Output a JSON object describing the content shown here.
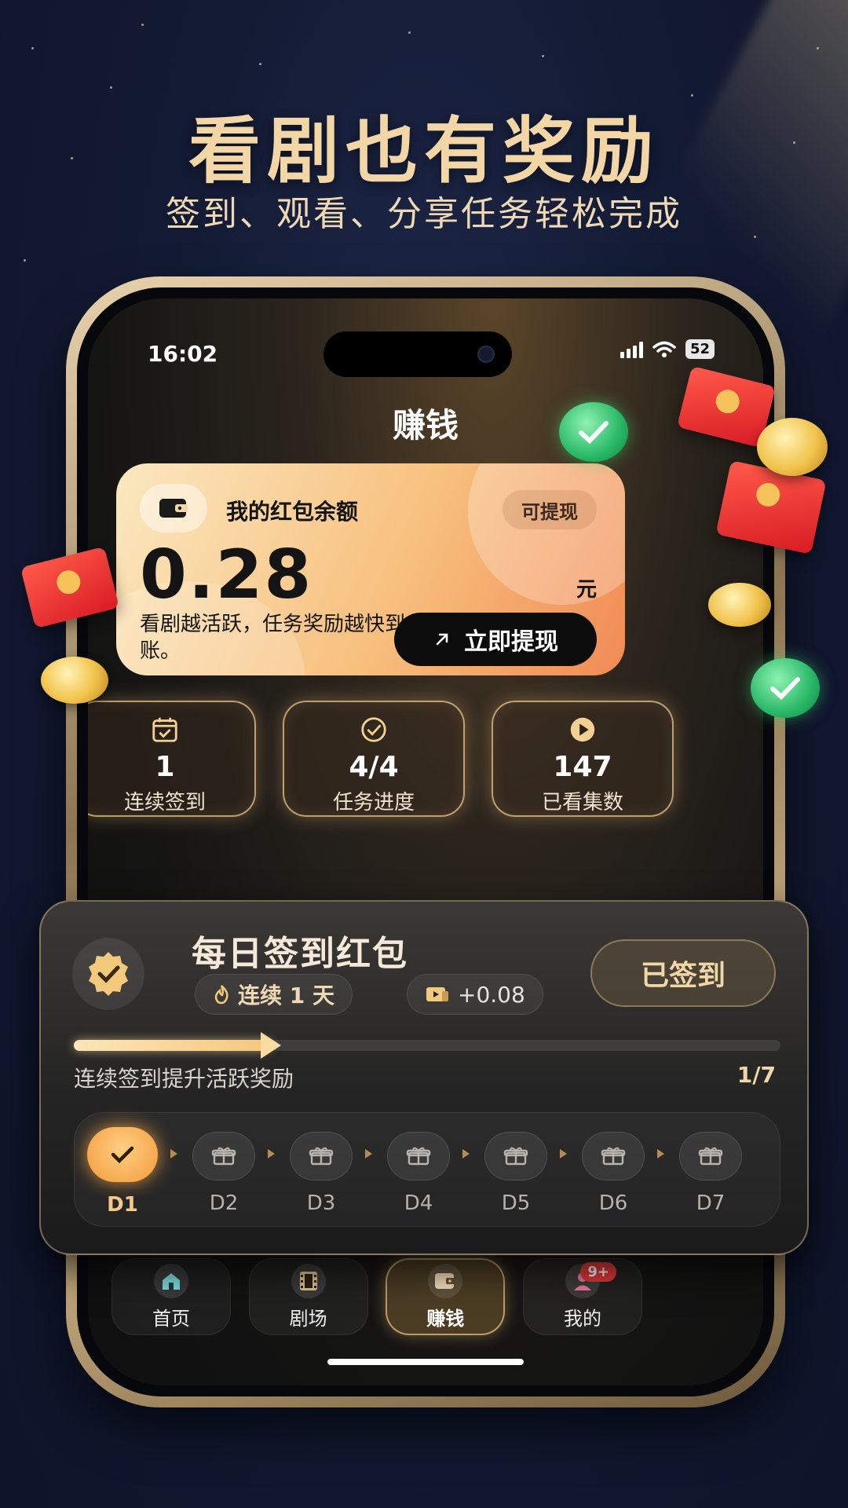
{
  "promo": {
    "headline": "看剧也有奖励",
    "subline": "签到、观看、分享任务轻松完成"
  },
  "status_bar": {
    "time": "16:02",
    "battery": "52"
  },
  "screen_title": "赚钱",
  "balance_card": {
    "label": "我的红包余额",
    "badge": "可提现",
    "amount": "0.28",
    "unit": "元",
    "description": "看剧越活跃，任务奖励越快到账。",
    "withdraw_button": "立即提现"
  },
  "stats": [
    {
      "icon": "calendar-check-icon",
      "value": "1",
      "label": "连续签到"
    },
    {
      "icon": "check-circle-icon",
      "value": "4/4",
      "label": "任务进度"
    },
    {
      "icon": "play-circle-icon",
      "value": "147",
      "label": "已看集数"
    }
  ],
  "checkin": {
    "title": "每日签到红包",
    "streak_chip": "连续 1 天",
    "bonus_chip": "+0.08",
    "signed_button": "已签到",
    "progress_label": "连续签到提升活跃奖励",
    "progress_count": "1/7",
    "progress_fraction": 0.28,
    "days": [
      "D1",
      "D2",
      "D3",
      "D4",
      "D5",
      "D6",
      "D7"
    ],
    "completed_days": 1
  },
  "tabbar": [
    {
      "label": "首页",
      "icon": "home-icon"
    },
    {
      "label": "剧场",
      "icon": "film-icon"
    },
    {
      "label": "赚钱",
      "icon": "wallet-icon",
      "active": true
    },
    {
      "label": "我的",
      "icon": "user-icon",
      "badge": "9+"
    }
  ],
  "colors": {
    "background": "#131a33",
    "gold": "#f3d6a6",
    "card_gradient_start": "#fbe8c0",
    "card_gradient_end": "#f18a54",
    "accent_orange": "#f39a3c",
    "badge_red": "#e63a3a"
  }
}
